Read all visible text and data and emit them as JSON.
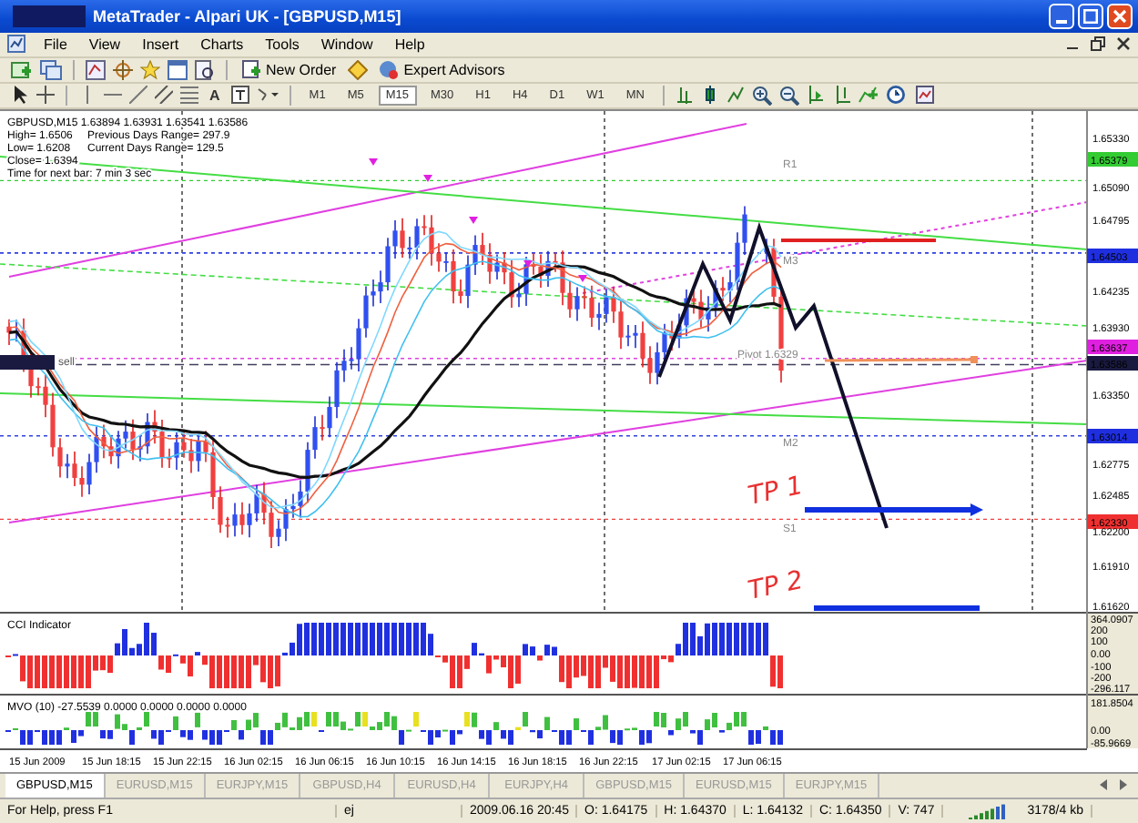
{
  "window": {
    "title": "MetaTrader - Alpari UK - [GBPUSD,M15]"
  },
  "menu": [
    "File",
    "View",
    "Insert",
    "Charts",
    "Tools",
    "Window",
    "Help"
  ],
  "toolbar": {
    "buttons": [
      "New Order",
      "Expert Advisors"
    ],
    "text_tool": "A"
  },
  "timeframes": [
    {
      "label": "M1",
      "selected": false
    },
    {
      "label": "M5",
      "selected": false
    },
    {
      "label": "M15",
      "selected": true
    },
    {
      "label": "M30",
      "selected": false
    },
    {
      "label": "H1",
      "selected": false
    },
    {
      "label": "H4",
      "selected": false
    },
    {
      "label": "D1",
      "selected": false
    },
    {
      "label": "W1",
      "selected": false
    },
    {
      "label": "MN",
      "selected": false
    }
  ],
  "chart": {
    "info": [
      "GBPUSD,M15  1.63894 1.63931 1.63541 1.63586",
      "High= 1.6506",
      "Previous Days Range= 297.9",
      "Low= 1.6208",
      "Current Days Range= 129.5",
      "Close= 1.6394",
      "Time for next bar: 7 min 3 sec"
    ],
    "levels": [
      "R1",
      "M3",
      "Pivot 1.6329",
      "M2",
      "S1"
    ],
    "sell_tag": "sell",
    "notes": [
      "TP 1",
      "TP 2"
    ],
    "price_axis": [
      {
        "label": "1.65330"
      },
      {
        "label": "1.65379",
        "color": "#33cc33"
      },
      {
        "label": "1.65090"
      },
      {
        "label": "1.64795"
      },
      {
        "label": "1.64503",
        "color": "#1f2fe0"
      },
      {
        "label": "1.64235"
      },
      {
        "label": "1.63930"
      },
      {
        "label": "1.63637",
        "color": "#e020e0"
      },
      {
        "label": "1.63586",
        "color": "#1a1a40"
      },
      {
        "label": "1.63350"
      },
      {
        "label": "1.63014",
        "color": "#1f2fe0"
      },
      {
        "label": "1.62775"
      },
      {
        "label": "1.62485"
      },
      {
        "label": "1.62330",
        "color": "#f03030"
      },
      {
        "label": "1.62200"
      },
      {
        "label": "1.61910"
      },
      {
        "label": "1.61620"
      }
    ]
  },
  "cci": {
    "title": "CCI Indicator",
    "scale": [
      "364.0907",
      "200",
      "100",
      "0.00",
      "-100",
      "-200",
      "-296.117"
    ]
  },
  "mvo": {
    "title": "MVO (10) -27.5539 0.0000 0.0000 0.0000 0.0000",
    "scale": [
      "181.8504",
      "0.00",
      "-85.9669"
    ]
  },
  "time_axis": [
    "15 Jun 2009",
    "15 Jun 18:15",
    "15 Jun 22:15",
    "16 Jun 02:15",
    "16 Jun 06:15",
    "16 Jun 10:15",
    "16 Jun 14:15",
    "16 Jun 18:15",
    "16 Jun 22:15",
    "17 Jun 02:15",
    "17 Jun 06:15"
  ],
  "tabs": [
    {
      "label": "GBPUSD,M15",
      "selected": true
    },
    {
      "label": "EURUSD,M15",
      "selected": false
    },
    {
      "label": "EURJPY,M15",
      "selected": false
    },
    {
      "label": "GBPUSD,H4",
      "selected": false
    },
    {
      "label": "EURUSD,H4",
      "selected": false
    },
    {
      "label": "EURJPY,H4",
      "selected": false
    },
    {
      "label": "GBPUSD,M15",
      "selected": false
    },
    {
      "label": "EURUSD,M15",
      "selected": false
    },
    {
      "label": "EURJPY,M15",
      "selected": false
    }
  ],
  "status_bar": [
    "For Help, press F1",
    "ej",
    "2009.06.16 20:45",
    "O: 1.64175",
    "H: 1.64370",
    "L: 1.64132",
    "C: 1.64350",
    "V: 747",
    "3178/4 kb"
  ]
}
